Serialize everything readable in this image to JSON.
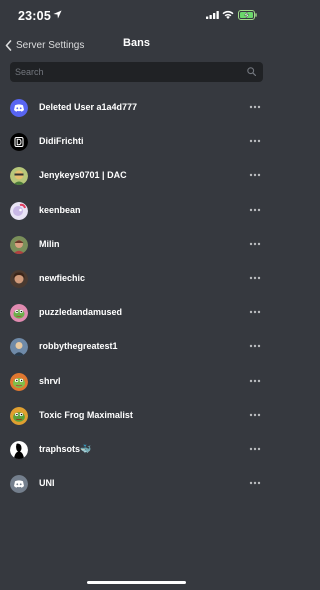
{
  "status_bar": {
    "time": "23:05"
  },
  "header": {
    "back_label": "Server Settings",
    "title": "Bans"
  },
  "search": {
    "placeholder": "Search",
    "value": ""
  },
  "bans": [
    {
      "name": "Deleted User a1a4d777",
      "avatar_icon": "discord-logo-icon",
      "avatar_color": "#5865f2"
    },
    {
      "name": "DidiFrichti",
      "avatar_icon": "letter-d-logo-icon",
      "avatar_color": "#000000"
    },
    {
      "name": "Jenykeys0701 | DAC",
      "avatar_icon": "cartoon-avatar-icon",
      "avatar_color": "#b7c77a"
    },
    {
      "name": "keenbean",
      "avatar_icon": "cartoon-avatar-icon",
      "avatar_color": "#c9b8e6"
    },
    {
      "name": "Milin",
      "avatar_icon": "cartoon-avatar-icon",
      "avatar_color": "#7a8f5a"
    },
    {
      "name": "newfiechic",
      "avatar_icon": "photo-avatar-icon",
      "avatar_color": "#d09a7a"
    },
    {
      "name": "puzzledandamused",
      "avatar_icon": "pepe-frog-avatar-icon",
      "avatar_color": "#e08ab0"
    },
    {
      "name": "robbythegreatest1",
      "avatar_icon": "cartoon-avatar-icon",
      "avatar_color": "#6f8aa8"
    },
    {
      "name": "shrvl",
      "avatar_icon": "pepe-frog-avatar-icon",
      "avatar_color": "#7fbf4a"
    },
    {
      "name": "Toxic Frog Maximalist",
      "avatar_icon": "pepe-frog-avatar-icon",
      "avatar_color": "#e0a030"
    },
    {
      "name": "traphsots🐳",
      "avatar_icon": "silhouette-avatar-icon",
      "avatar_color": "#ffffff"
    },
    {
      "name": "UNI",
      "avatar_icon": "discord-logo-icon",
      "avatar_color": "#747f8d"
    }
  ],
  "colors": {
    "background": "#36393f",
    "search_bg": "#202225",
    "text": "#ffffff",
    "muted": "#72767d"
  }
}
